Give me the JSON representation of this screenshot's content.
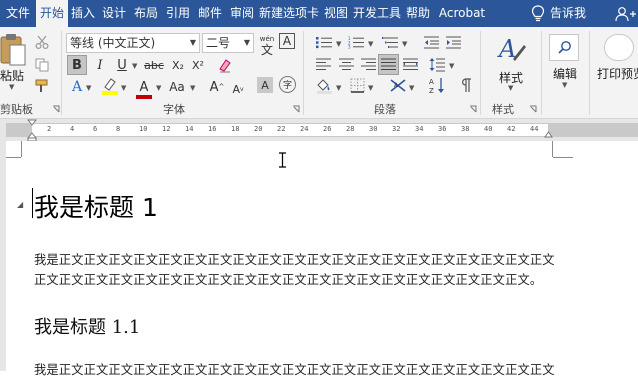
{
  "tabs": [
    {
      "label": "文件",
      "active": false
    },
    {
      "label": "开始",
      "active": true
    },
    {
      "label": "插入",
      "active": false
    },
    {
      "label": "设计",
      "active": false
    },
    {
      "label": "布局",
      "active": false
    },
    {
      "label": "引用",
      "active": false
    },
    {
      "label": "邮件",
      "active": false
    },
    {
      "label": "审阅",
      "active": false
    },
    {
      "label": "新建选项卡",
      "active": false
    },
    {
      "label": "视图",
      "active": false
    },
    {
      "label": "开发工具",
      "active": false
    },
    {
      "label": "帮助",
      "active": false
    },
    {
      "label": "Acrobat",
      "active": false
    }
  ],
  "tell_me": "告诉我",
  "clipboard": {
    "paste": "粘贴",
    "group": "剪贴板"
  },
  "font": {
    "name": "等线 (中文正文)",
    "size": "二号",
    "wen": "wén",
    "wen_char": "文",
    "bordered_a": "A",
    "group": "字体",
    "bold": "B",
    "italic": "I",
    "underline": "U",
    "strike": "abc",
    "sub": "X₂",
    "sup": "X²",
    "aa": "Aa",
    "grow": "A",
    "shrink": "A",
    "shade": "A",
    "circle": "字",
    "effects": "A",
    "highlight_color": "#ffff00",
    "font_color": "#c00000"
  },
  "paragraph": {
    "group": "段落"
  },
  "styles": {
    "label": "样式",
    "group": "样式"
  },
  "editing": {
    "label": "编辑"
  },
  "print_preview": {
    "label": "打印预览"
  },
  "ruler_marks": [
    "2",
    "4",
    "6",
    "8",
    "10",
    "12",
    "14",
    "16",
    "18",
    "20",
    "22",
    "24",
    "26",
    "28",
    "30",
    "32",
    "34",
    "36",
    "38",
    "40",
    "42",
    "44"
  ],
  "document": {
    "heading1": "我是标题 1",
    "body_line1": "我是正文正文正文正文正文正文正文正文正文正文正文正文正文正文正文正文正文正文正文正文",
    "body_line2": "正文正文正文正文正文正文正文正文正文正文正文正文正文正文正文正文正文正文正文正文。",
    "heading2": "我是标题 1.1",
    "body2_line1": "我是正文正文正文正文正文正文正文正文正文正文正文正文正文正文正文正文正文正文正文正文"
  },
  "colors": {
    "accent": "#2b579a",
    "ribbon": "#f3f3f3"
  }
}
